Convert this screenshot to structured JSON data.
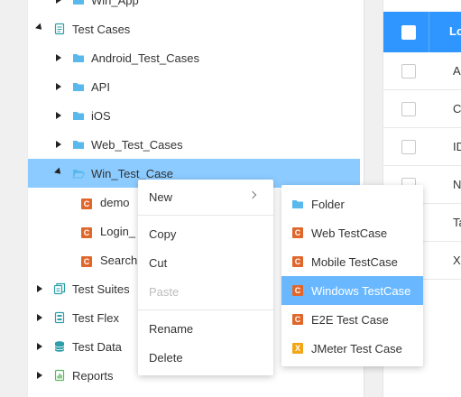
{
  "tree": {
    "items": [
      {
        "label": "Win_App",
        "icon": "folder-icon",
        "toggle": "collapsed",
        "level": 1
      },
      {
        "label": "Test Cases",
        "icon": "file-list-icon",
        "toggle": "expanded",
        "level": 0
      },
      {
        "label": "Android_Test_Cases",
        "icon": "folder-icon",
        "toggle": "collapsed",
        "level": 1
      },
      {
        "label": "API",
        "icon": "folder-icon",
        "toggle": "collapsed",
        "level": 1
      },
      {
        "label": "iOS",
        "icon": "folder-icon",
        "toggle": "collapsed",
        "level": 1
      },
      {
        "label": "Web_Test_Cases",
        "icon": "folder-icon",
        "toggle": "collapsed",
        "level": 1
      },
      {
        "label": "Win_Test_Case",
        "icon": "folder-open-icon",
        "toggle": "expanded",
        "level": 1,
        "selected": true
      },
      {
        "label": "demo",
        "icon": "testcase-c-icon",
        "toggle": "none",
        "level": 2
      },
      {
        "label": "Login_",
        "icon": "testcase-c-icon",
        "toggle": "none",
        "level": 2
      },
      {
        "label": "Search",
        "icon": "testcase-c-icon",
        "toggle": "none",
        "level": 2
      },
      {
        "label": "Test Suites",
        "icon": "test-suites-icon",
        "toggle": "collapsed",
        "level": 0
      },
      {
        "label": "Test Flex",
        "icon": "test-flex-icon",
        "toggle": "collapsed",
        "level": 0
      },
      {
        "label": "Test Data",
        "icon": "database-icon",
        "toggle": "collapsed",
        "level": 0
      },
      {
        "label": "Reports",
        "icon": "reports-icon",
        "toggle": "collapsed",
        "level": 0
      }
    ]
  },
  "grid": {
    "header_label": "Lo",
    "rows": [
      "Ac",
      "Cl",
      "ID",
      "N",
      "Ta",
      "XI"
    ]
  },
  "context_menu": {
    "new_label": "New",
    "copy_label": "Copy",
    "cut_label": "Cut",
    "paste_label": "Paste",
    "rename_label": "Rename",
    "delete_label": "Delete"
  },
  "new_submenu": {
    "items": [
      {
        "label": "Folder",
        "icon": "folder-icon"
      },
      {
        "label": "Web TestCase",
        "icon": "testcase-c-icon"
      },
      {
        "label": "Mobile TestCase",
        "icon": "testcase-c-icon"
      },
      {
        "label": "Windows TestCase",
        "icon": "testcase-c-icon",
        "active": true
      },
      {
        "label": "E2E Test Case",
        "icon": "testcase-c-icon"
      },
      {
        "label": "JMeter Test Case",
        "icon": "jmeter-x-icon"
      }
    ]
  },
  "colors": {
    "accent": "#2f96ff",
    "selection": "#8ccbff",
    "menu_highlight": "#69b8ff",
    "testcase_icon": "#e0672c",
    "jmeter_icon": "#f2a516",
    "folder_icon": "#5ab9ec",
    "suite_icon": "#2d9fa8",
    "reports_icon": "#5cb85c"
  }
}
